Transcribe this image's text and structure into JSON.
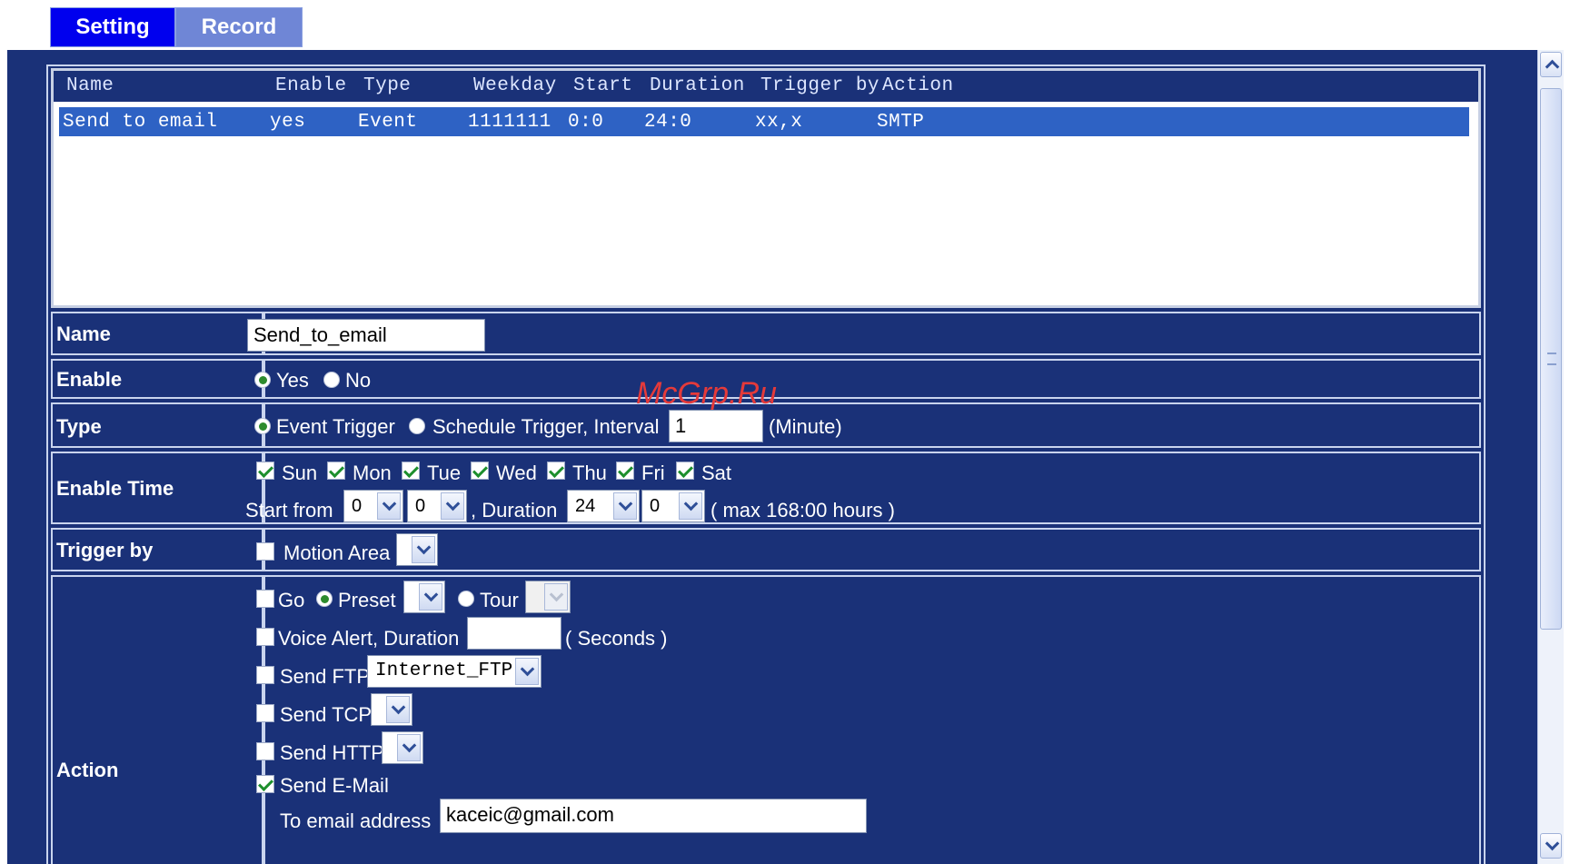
{
  "tabs": {
    "setting": "Setting",
    "record": "Record"
  },
  "list": {
    "headers": [
      "Name",
      "Enable",
      "Type",
      "Weekday",
      "Start",
      "Duration",
      "Trigger by",
      "Action"
    ],
    "rows": [
      [
        "Send to email",
        "yes",
        "Event",
        "1111111",
        "0:0",
        "24:0",
        "xx,x",
        "SMTP"
      ]
    ]
  },
  "form": {
    "name": {
      "label": "Name",
      "value": "Send_to_email"
    },
    "enable": {
      "label": "Enable",
      "yes": "Yes",
      "no": "No",
      "selected": "Yes"
    },
    "type": {
      "label": "Type",
      "event": "Event Trigger",
      "schedule": "Schedule Trigger, Interval",
      "interval_value": "1",
      "unit": "(Minute)",
      "selected": "Event Trigger"
    },
    "enable_time": {
      "label": "Enable Time",
      "days": [
        {
          "name": "Sun",
          "checked": true
        },
        {
          "name": "Mon",
          "checked": true
        },
        {
          "name": "Tue",
          "checked": true
        },
        {
          "name": "Wed",
          "checked": true
        },
        {
          "name": "Thu",
          "checked": true
        },
        {
          "name": "Fri",
          "checked": true
        },
        {
          "name": "Sat",
          "checked": true
        }
      ],
      "start_label": "Start from",
      "start_hour": "0",
      "start_min": "0",
      "duration_label": ", Duration",
      "duration_hour": "24",
      "duration_min": "0",
      "max_note": "( max 168:00 hours )"
    },
    "trigger_by": {
      "label": "Trigger by",
      "motion_area": "Motion Area",
      "checked": false,
      "select_value": ""
    },
    "action": {
      "label": "Action",
      "go": "Go",
      "go_checked": false,
      "preset": "Preset",
      "tour": "Tour",
      "selected_mode": "Preset",
      "voice_alert": "Voice Alert, Duration",
      "voice_checked": false,
      "voice_value": "",
      "seconds": "( Seconds )",
      "send_ftp": "Send FTP",
      "ftp_checked": false,
      "ftp_value": "Internet_FTP",
      "send_tcp": "Send TCP",
      "tcp_checked": false,
      "send_http": "Send HTTP",
      "http_checked": false,
      "send_email": "Send E-Mail",
      "email_checked": true,
      "to_email_label": "To email address",
      "to_email_value": "kaceic@gmail.com"
    }
  },
  "watermark": "McGrp.Ru",
  "colors": {
    "panel": "#1a3178",
    "tab_active": "#0000ee",
    "tab_inactive": "#6f86d6",
    "selected_row": "#2e62c4"
  }
}
